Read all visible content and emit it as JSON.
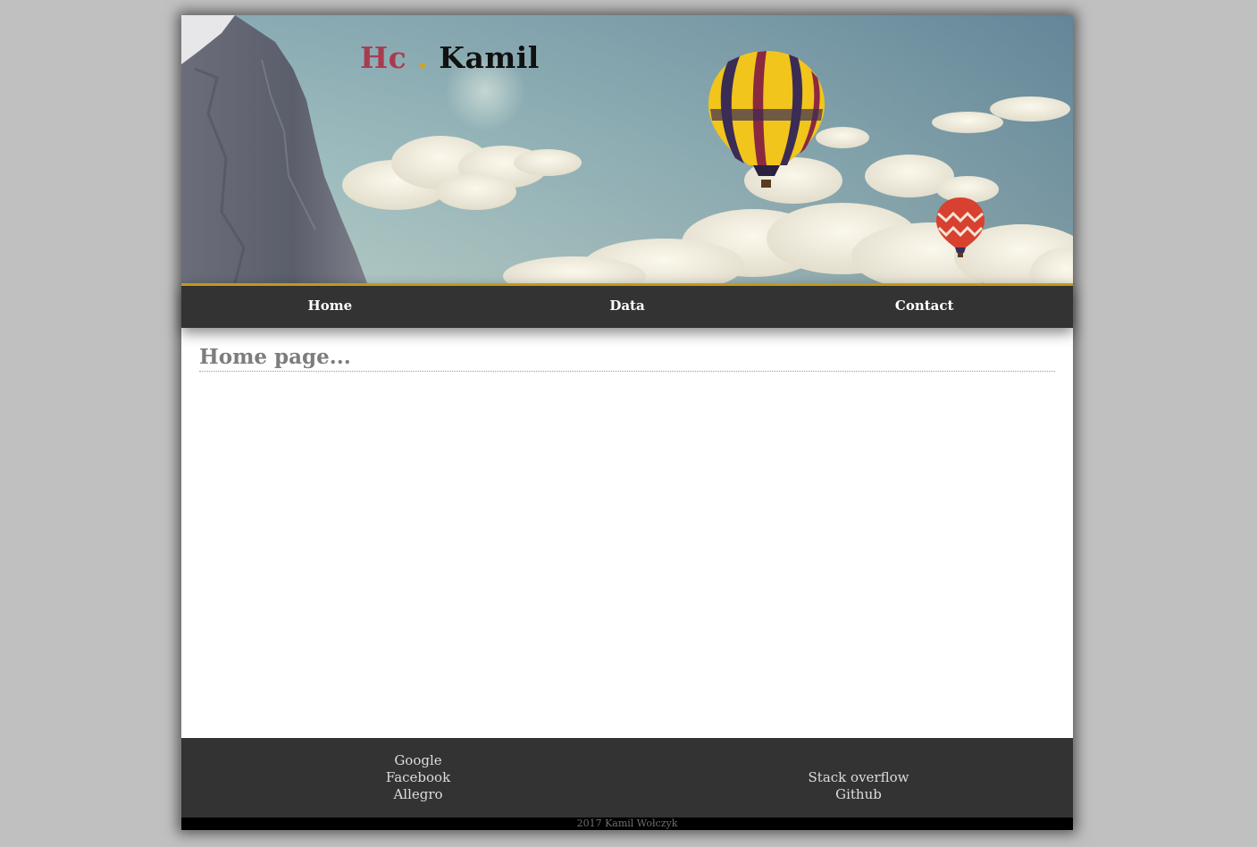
{
  "header": {
    "logo_part1": "Hc",
    "logo_dot": ".",
    "logo_part2": "Kamil"
  },
  "nav": {
    "items": [
      {
        "label": "Home"
      },
      {
        "label": "Data"
      },
      {
        "label": "Contact"
      }
    ]
  },
  "main": {
    "heading": "Home page..."
  },
  "footer": {
    "left_links": [
      "Google",
      "Facebook",
      "Allegro"
    ],
    "right_links": [
      "Stack overflow",
      "Github"
    ],
    "copyright": "2017 Kamil Wołczyk"
  },
  "colors": {
    "background": "#c0c0c0",
    "nav_background": "#333333",
    "nav_accent": "#c29a14",
    "logo_red": "#a83c4f",
    "logo_dot": "#d1a51c",
    "heading_gray": "#7d7d7d"
  }
}
